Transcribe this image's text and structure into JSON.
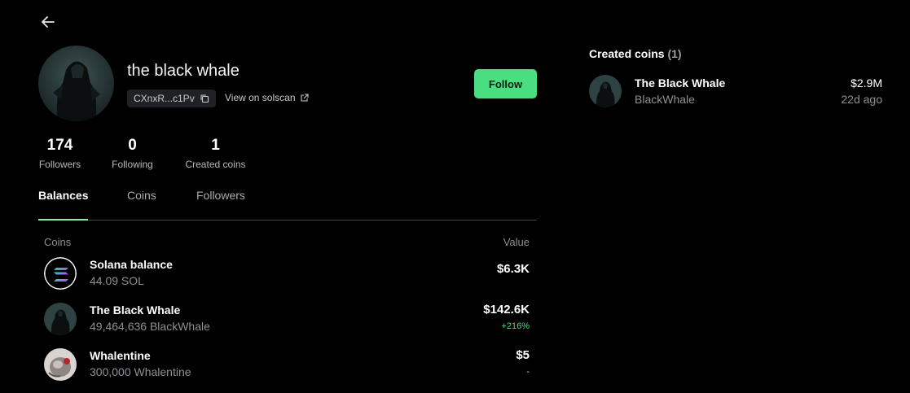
{
  "profile": {
    "username": "the black whale",
    "address_short": "CXnxR...c1Pv",
    "solscan_label": "View on solscan",
    "avatar_icon": "black-whale-avatar",
    "follow_label": "Follow"
  },
  "stats": [
    {
      "value": "174",
      "label": "Followers"
    },
    {
      "value": "0",
      "label": "Following"
    },
    {
      "value": "1",
      "label": "Created coins"
    }
  ],
  "tabs": [
    {
      "label": "Balances",
      "active": true
    },
    {
      "label": "Coins",
      "active": false
    },
    {
      "label": "Followers",
      "active": false
    }
  ],
  "balances": {
    "col_coins": "Coins",
    "col_value": "Value",
    "rows": [
      {
        "name": "Solana balance",
        "amount": "44.09 SOL",
        "value": "$6.3K",
        "change": "",
        "icon": "solana-icon"
      },
      {
        "name": "The Black Whale",
        "amount": "49,464,636 BlackWhale",
        "value": "$142.6K",
        "change": "+216%",
        "icon": "black-whale-coin-icon"
      },
      {
        "name": "Whalentine",
        "amount": "300,000 Whalentine",
        "value": "$5",
        "change": "-",
        "icon": "whalentine-coin-icon"
      }
    ]
  },
  "created_coins": {
    "title": "Created coins",
    "count": "(1)",
    "items": [
      {
        "name": "The Black Whale",
        "symbol": "BlackWhale",
        "market_cap": "$2.9M",
        "age": "22d ago",
        "icon": "black-whale-coin-icon"
      }
    ]
  },
  "colors": {
    "accent_green": "#4ade80",
    "positive_change": "#4ade80",
    "background": "#000000"
  }
}
